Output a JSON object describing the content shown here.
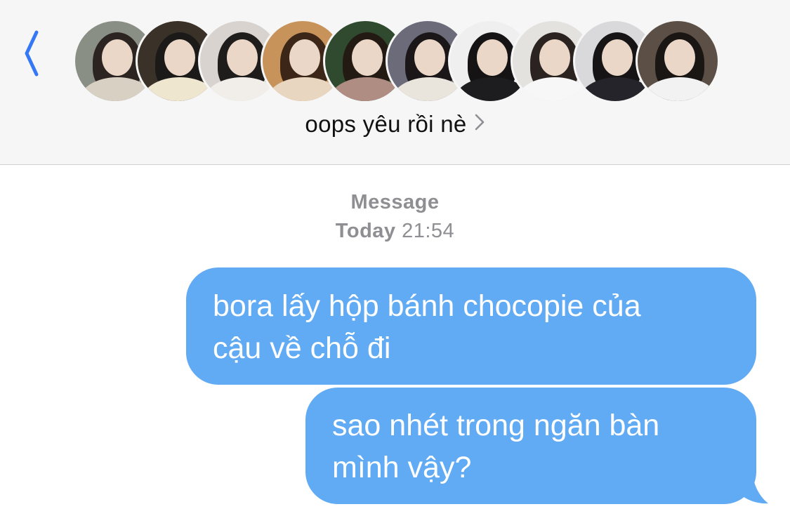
{
  "header": {
    "back_icon": "chevron-left-icon",
    "group_name": "oops yêu rồi nè",
    "disclosure_icon": "chevron-right-icon",
    "avatars": [
      {
        "bg": "#8a8f86",
        "hair": "#2b2420",
        "body": "#d9d0c4"
      },
      {
        "bg": "#3a3128",
        "hair": "#1c1a18",
        "body": "#efe6cf"
      },
      {
        "bg": "#d8d3cf",
        "hair": "#1f1c1c",
        "body": "#f1eeea"
      },
      {
        "bg": "#c7935a",
        "hair": "#3b2617",
        "body": "#e8d6c0"
      },
      {
        "bg": "#2f4a2e",
        "hair": "#241a14",
        "body": "#b08d82"
      },
      {
        "bg": "#6b6b7a",
        "hair": "#1b1718",
        "body": "#e9e4dc"
      },
      {
        "bg": "#efefef",
        "hair": "#151313",
        "body": "#1d1d1f"
      },
      {
        "bg": "#e4e2df",
        "hair": "#2b2320",
        "body": "#f7f7f7"
      },
      {
        "bg": "#d9d9dc",
        "hair": "#161414",
        "body": "#24242a"
      },
      {
        "bg": "#5c5046",
        "hair": "#1a1614",
        "body": "#f2f2f2"
      }
    ]
  },
  "thread": {
    "service_label": "Message",
    "day_label": "Today",
    "time_label": "21:54",
    "messages": [
      {
        "line1": "bora lấy hộp bánh chocopie của",
        "line2": "cậu về chỗ đi"
      },
      {
        "line1": "sao nhét trong ngăn bàn",
        "line2": "mình vậy?"
      }
    ]
  },
  "colors": {
    "accent": "#3478f6",
    "bubble": "#61aaf4",
    "header_bg": "#f6f6f6",
    "meta_text": "#8e8e93"
  }
}
